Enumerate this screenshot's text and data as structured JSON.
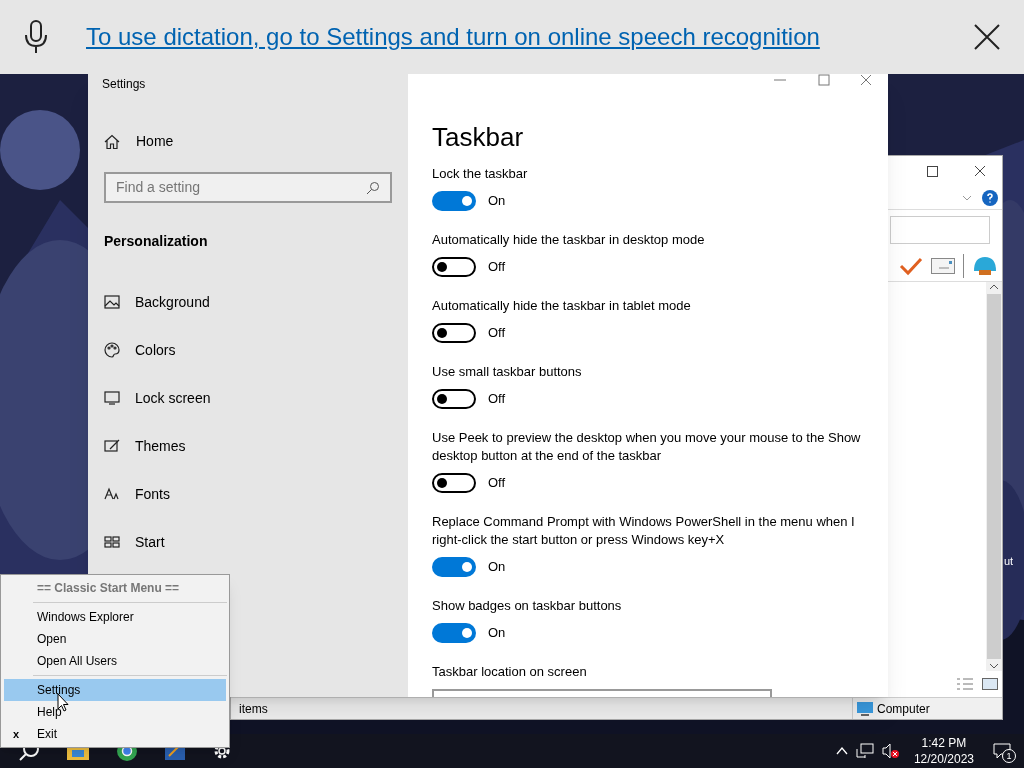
{
  "dictation_bar": {
    "message": "To use dictation, go to Settings and turn on online speech recognition"
  },
  "settings_window": {
    "title": "Settings",
    "sidebar": {
      "home": "Home",
      "search": {
        "placeholder": "Find a setting"
      },
      "section": "Personalization",
      "items": [
        {
          "label": "Background",
          "selected": false
        },
        {
          "label": "Colors",
          "selected": false
        },
        {
          "label": "Lock screen",
          "selected": false
        },
        {
          "label": "Themes",
          "selected": false
        },
        {
          "label": "Fonts",
          "selected": false
        },
        {
          "label": "Start",
          "selected": false
        }
      ]
    },
    "page_title": "Taskbar",
    "settings": [
      {
        "kind": "toggle",
        "label": "Lock the taskbar",
        "on": true,
        "state": "On"
      },
      {
        "kind": "toggle",
        "label": "Automatically hide the taskbar in desktop mode",
        "on": false,
        "state": "Off"
      },
      {
        "kind": "toggle",
        "label": "Automatically hide the taskbar in tablet mode",
        "on": false,
        "state": "Off"
      },
      {
        "kind": "toggle",
        "label": "Use small taskbar buttons",
        "on": false,
        "state": "Off"
      },
      {
        "kind": "toggle",
        "label": "Use Peek to preview the desktop when you move your mouse to the Show desktop button at the end of the taskbar",
        "on": false,
        "state": "Off"
      },
      {
        "kind": "toggle",
        "label": "Replace Command Prompt with Windows PowerShell in the menu when I right-click the start button or press Windows key+X",
        "on": true,
        "state": "On"
      },
      {
        "kind": "toggle",
        "label": "Show badges on taskbar buttons",
        "on": true,
        "state": "On"
      },
      {
        "kind": "dropdown",
        "label": "Taskbar location on screen"
      }
    ]
  },
  "explorer_window": {
    "status_items": "items",
    "status_location": "Computer"
  },
  "desktop_label": "ut",
  "start_menu": {
    "items": [
      {
        "kind": "header",
        "label": "== Classic Start Menu =="
      },
      {
        "kind": "separator"
      },
      {
        "kind": "item",
        "label": "Windows Explorer",
        "selected": false
      },
      {
        "kind": "item",
        "label": "Open",
        "selected": false
      },
      {
        "kind": "item",
        "label": "Open All Users",
        "selected": false
      },
      {
        "kind": "separator"
      },
      {
        "kind": "item",
        "label": "Settings",
        "selected": true
      },
      {
        "kind": "item",
        "label": "Help",
        "selected": false
      },
      {
        "kind": "item",
        "label": "Exit",
        "selected": false,
        "mark": "x"
      }
    ]
  },
  "taskbar": {
    "time": "1:42 PM",
    "date": "12/20/2023",
    "notifications": "1"
  }
}
